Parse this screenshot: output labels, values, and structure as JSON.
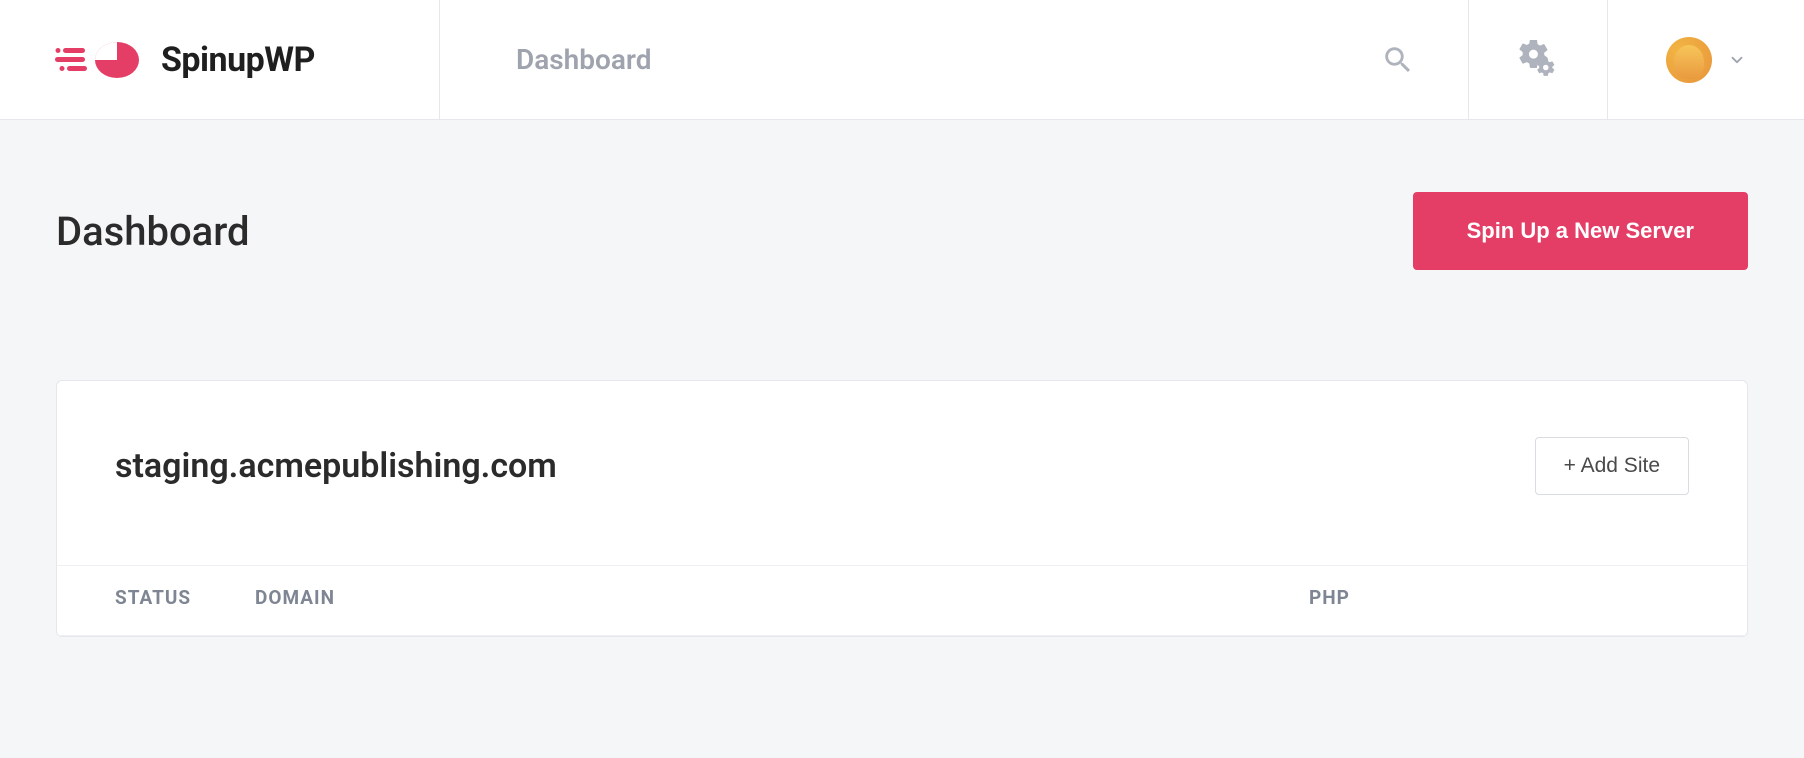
{
  "brand": {
    "name": "SpinupWP"
  },
  "header": {
    "nav_label": "Dashboard"
  },
  "page": {
    "title": "Dashboard",
    "primary_action": "Spin Up a New Server"
  },
  "server": {
    "name": "staging.acmepublishing.com",
    "add_site_label": "+ Add Site",
    "columns": {
      "status": "STATUS",
      "domain": "DOMAIN",
      "php": "PHP"
    }
  },
  "colors": {
    "accent": "#e53e66"
  }
}
